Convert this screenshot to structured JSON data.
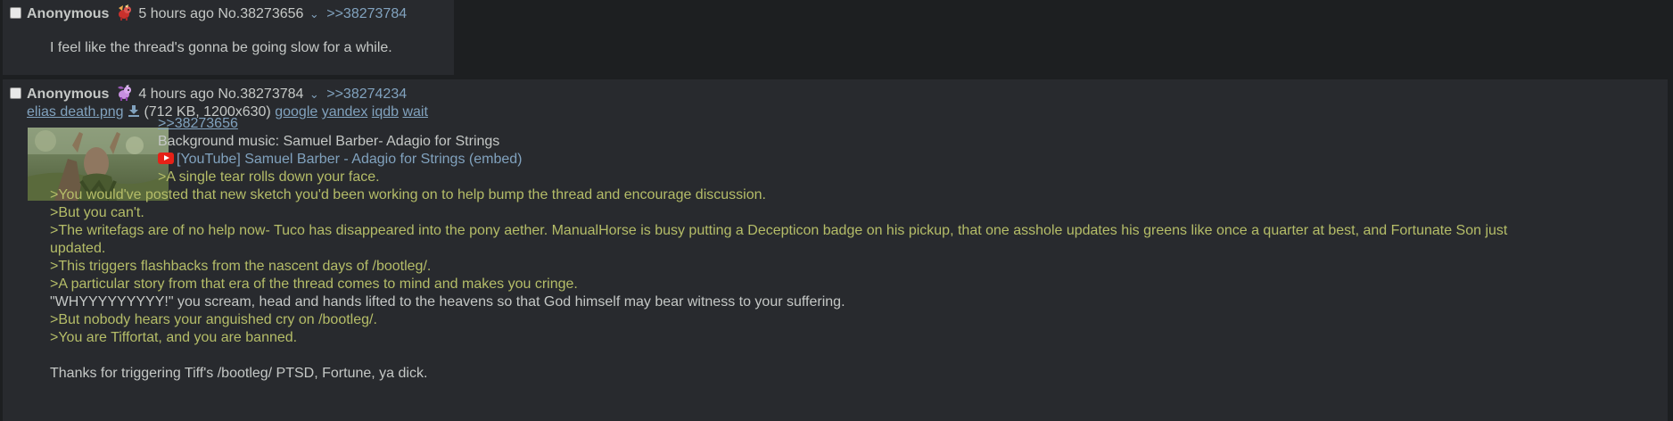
{
  "posts": [
    {
      "name": "Anonymous",
      "time": "5 hours ago",
      "post_no": "No.38273656",
      "chevron": "⌄",
      "backlink": ">>38273784",
      "lines": [
        "I feel like the thread's gonna be going slow for a while."
      ],
      "flag_icon": "pony-flag-icon"
    },
    {
      "name": "Anonymous",
      "time": "4 hours ago",
      "post_no": "No.38273784",
      "chevron": "⌄",
      "backlink": ">>38274234",
      "file": {
        "filename": "elias death.png",
        "details": "(712 KB, 1200x630)",
        "search_links": [
          "google",
          "yandex",
          "iqdb",
          "wait"
        ]
      },
      "quote_link": ">>38273656",
      "bg_music": "Background music: Samuel Barber- Adagio for Strings",
      "youtube": "[YouTube] Samuel Barber - Adagio for Strings (embed)",
      "lines": [
        ">A single tear rolls down your face.",
        ">You would've posted that new sketch you'd been working on to help bump the thread and encourage discussion.",
        ">But you can't.",
        ">The writefags are of no help now- Tuco has disappeared into the pony aether. ManualHorse is busy putting a Decepticon badge on his pickup, that one asshole updates his greens like once a quarter at best, and Fortunate Son just",
        "updated.",
        ">This triggers flashbacks from the nascent days of /bootleg/.",
        ">A particular story from that era of the thread comes to mind and makes you cringe.",
        "\"WHYYYYYYYYY!\" you scream, head and hands lifted to the heavens so that God himself may bear witness to your suffering.",
        ">But nobody hears your anguished cry on /bootleg/.",
        ">You are Tiffortat, and you are banned.",
        "Thanks for triggering Tiff's /bootleg/ PTSD, Fortune, ya dick."
      ],
      "flag_icon": "pony-flag-icon"
    }
  ],
  "colors": {
    "background": "#1d1f21",
    "post_bg": "#282a2e",
    "text": "#c5c8c6",
    "link": "#81a2be",
    "greentext": "#b5bd68"
  }
}
